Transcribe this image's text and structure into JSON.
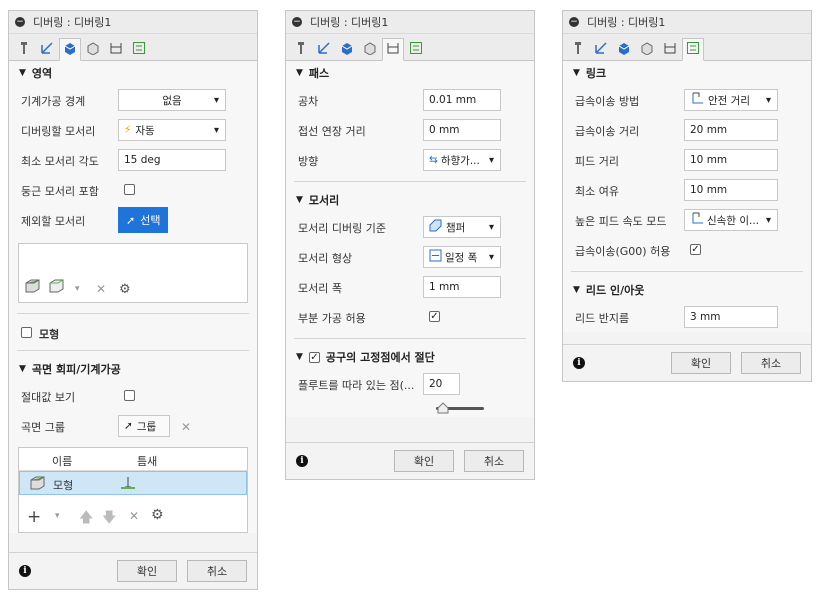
{
  "panel1": {
    "title": "디버링 : 디버링1",
    "area_section": "영역",
    "machining_boundary_label": "기계가공 경계",
    "machining_boundary_value": "없음",
    "edges_label": "디버링할 모서리",
    "edges_value": "자동",
    "min_angle_label": "최소 모서리 각도",
    "min_angle_value": "15 deg",
    "round_edges_label": "둥근 모서리 포함",
    "exclude_edges_label": "제외할 모서리",
    "select_label": "선택",
    "model_label": "모형",
    "surface_section": "곡면 회피/기계가공",
    "absolute_view_label": "절대값 보기",
    "surface_group_label": "곡면 그룹",
    "group_button": "그룹",
    "table_name_header": "이름",
    "table_gap_header": "틈새",
    "table_row_name": "모형",
    "ok": "확인",
    "cancel": "취소"
  },
  "panel2": {
    "title": "디버링 : 디버링1",
    "pass_section": "패스",
    "tolerance_label": "공차",
    "tolerance_value": "0.01 mm",
    "tangent_ext_label": "접선 연장 거리",
    "tangent_ext_value": "0 mm",
    "direction_label": "방향",
    "direction_value": "하향가...",
    "edge_section": "모서리",
    "edge_basis_label": "모서리 디버링 기준",
    "edge_basis_value": "챔퍼",
    "edge_shape_label": "모서리 형상",
    "edge_shape_value": "일정 폭",
    "edge_width_label": "모서리 폭",
    "edge_width_value": "1 mm",
    "partial_label": "부분 가공 허용",
    "fixed_point_section": "공구의 고정점에서 절단",
    "flute_label": "플루트를 따라 있는 점(...",
    "flute_value": "20",
    "slider_level": 0.0,
    "ok": "확인",
    "cancel": "취소"
  },
  "panel3": {
    "title": "디버링 : 디버링1",
    "link_section": "링크",
    "rapid_method_label": "급속이송 방법",
    "rapid_method_value": "안전 거리",
    "rapid_distance_label": "급속이송 거리",
    "rapid_distance_value": "20 mm",
    "feed_distance_label": "피드 거리",
    "feed_distance_value": "10 mm",
    "min_clearance_label": "최소 여유",
    "min_clearance_value": "10 mm",
    "high_feed_label": "높은 피드 속도 모드",
    "high_feed_value": "신속한 이...",
    "g00_label": "급속이송(G00) 허용",
    "lead_section": "리드 인/아웃",
    "lead_radius_label": "리드 반지름",
    "lead_radius_value": "3 mm",
    "ok": "확인",
    "cancel": "취소"
  },
  "colors": {
    "accent": "#1e74d8",
    "selected_row": "#cfe6f6",
    "icon_green": "#59b54a"
  }
}
